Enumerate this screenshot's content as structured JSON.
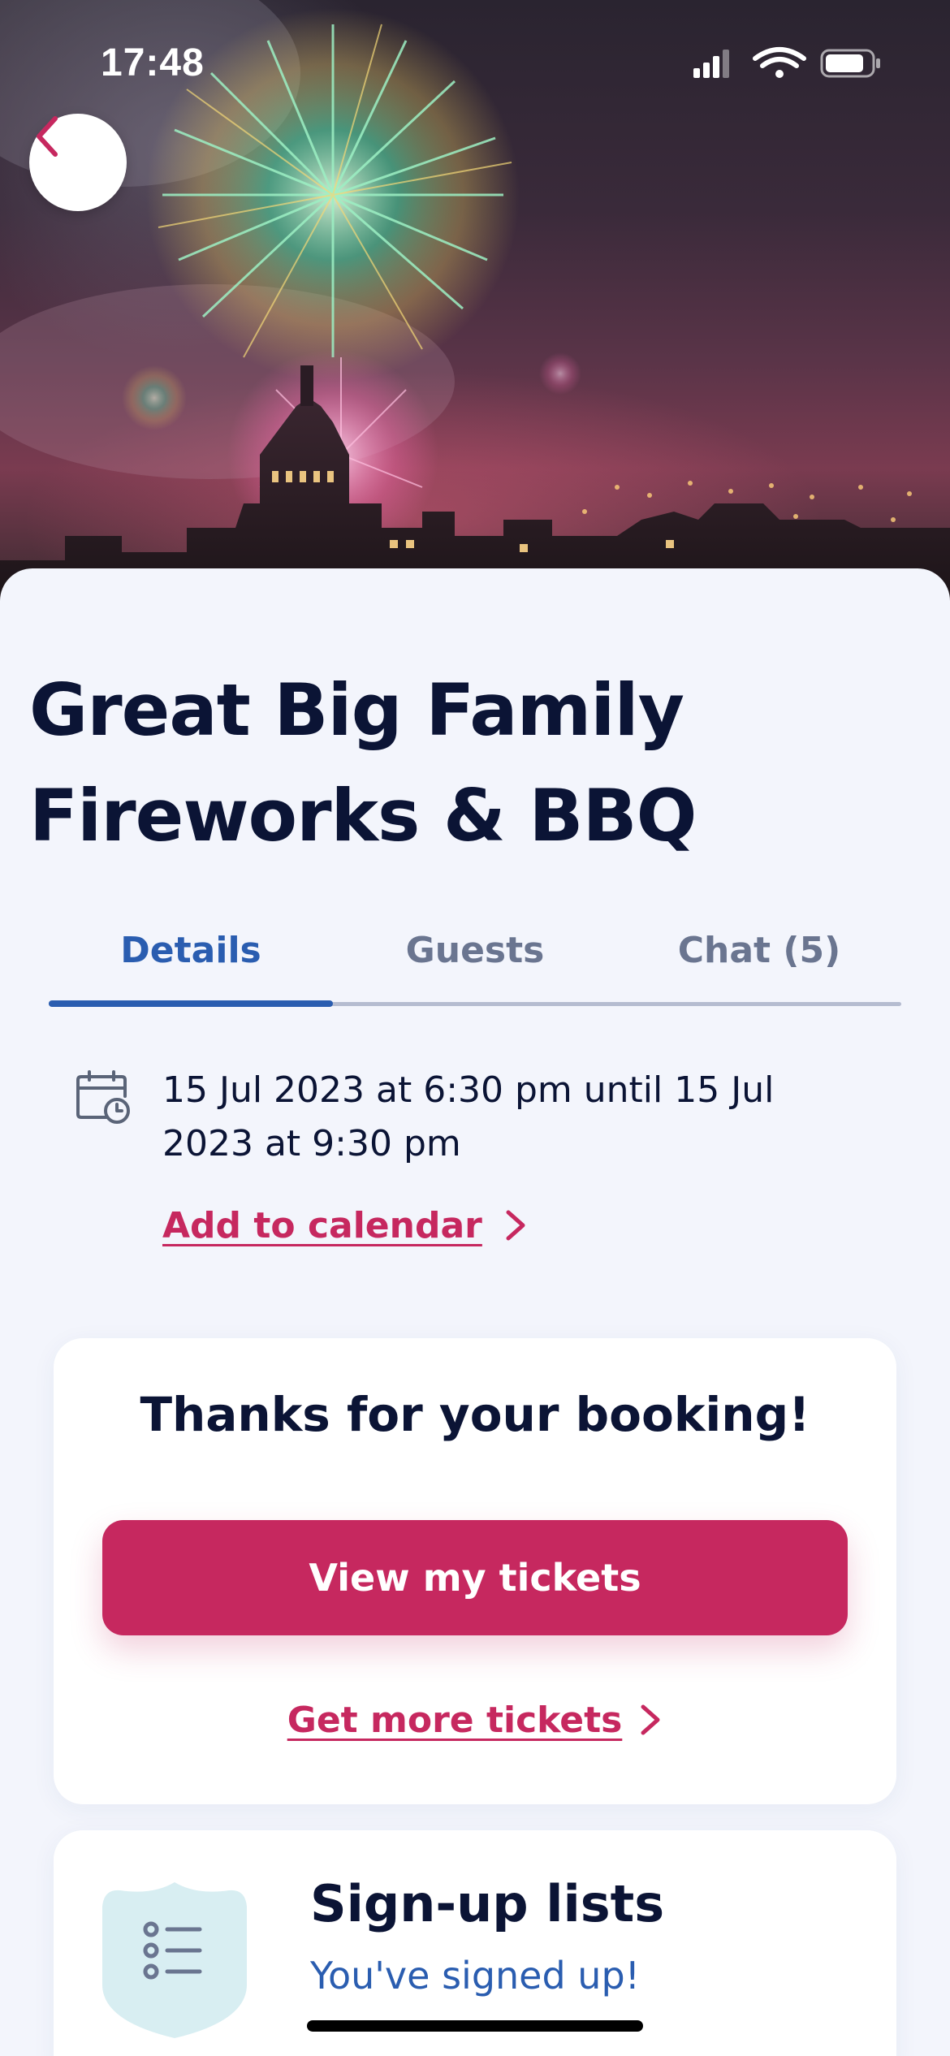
{
  "status_bar": {
    "time": "17:48"
  },
  "event": {
    "title": "Great Big Family Fireworks & BBQ"
  },
  "tabs": [
    {
      "label": "Details",
      "active": true
    },
    {
      "label": "Guests",
      "active": false
    },
    {
      "label": "Chat (5)",
      "active": false
    }
  ],
  "details": {
    "date_range": "15 Jul 2023 at 6:30 pm until 15 Jul 2023 at 9:30 pm",
    "add_to_calendar": "Add to calendar"
  },
  "booking": {
    "title": "Thanks for your booking!",
    "view_tickets": "View my tickets",
    "get_more_tickets": "Get more tickets"
  },
  "signup": {
    "title": "Sign-up lists",
    "status": "You've signed up!"
  },
  "icons": {
    "back": "chevron-left-icon",
    "calendar": "calendar-clock-icon",
    "link_chevron": "chevron-right-icon",
    "signup_badge": "checklist-icon"
  },
  "colors": {
    "accent": "#c6285f",
    "tab_active": "#2a5db0",
    "text_primary": "#0b1435",
    "background": "#f3f5fc",
    "badge": "#d8eef2"
  }
}
